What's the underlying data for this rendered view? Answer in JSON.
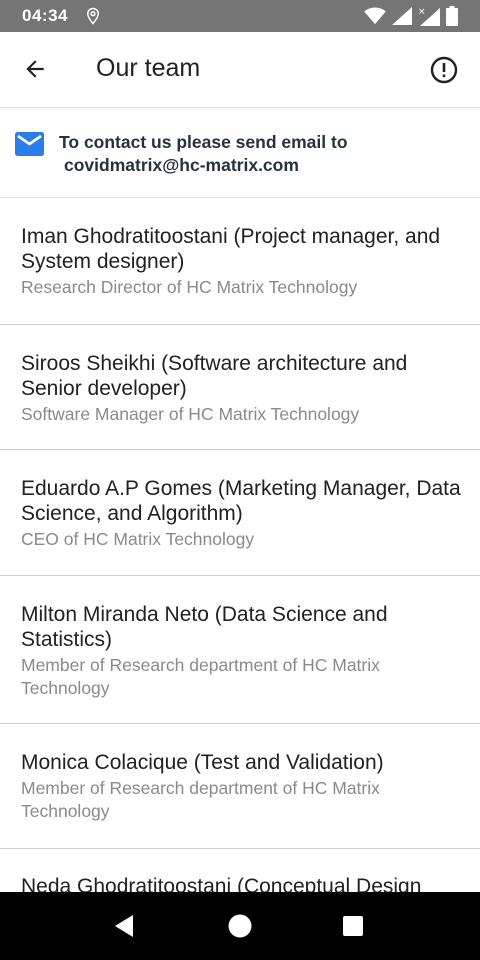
{
  "status_bar": {
    "time": "04:34",
    "icons": [
      "location-icon",
      "wifi-icon",
      "signal-icon",
      "signal-no-data-icon",
      "battery-icon"
    ]
  },
  "app_bar": {
    "title": "Our team",
    "back_icon": "arrow-back-icon",
    "info_icon": "info-circle-icon"
  },
  "contact": {
    "icon": "mail-icon",
    "line1": "To contact us please send email to",
    "line2": "covidmatrix@hc-matrix.com"
  },
  "members": [
    {
      "name": "Iman Ghodratitoostani (Project manager, and System designer)",
      "role": "Research Director of HC Matrix Technology"
    },
    {
      "name": "Siroos Sheikhi (Software architecture and Senior developer)",
      "role": "Software Manager of HC Matrix Technology"
    },
    {
      "name": "Eduardo A.P Gomes (Marketing Manager, Data Science, and Algorithm)",
      "role": "CEO of HC Matrix Technology"
    },
    {
      "name": "Milton Miranda Neto (Data Science and Statistics)",
      "role": "Member of Research department of HC Matrix Technology"
    },
    {
      "name": "Monica Colacique (Test and Validation)",
      "role": "Member of Research department of HC Matrix Technology"
    },
    {
      "name": "Neda Ghodratitoostani (Conceptual Design",
      "role": ""
    }
  ],
  "nav_bar": {
    "icons": [
      "back-triangle-icon",
      "home-circle-icon",
      "recents-square-icon"
    ]
  },
  "colors": {
    "status_bar": "#757575",
    "accent_mail": "#2b7de9",
    "title_text": "#212121",
    "secondary_text": "#8a8a8a"
  }
}
